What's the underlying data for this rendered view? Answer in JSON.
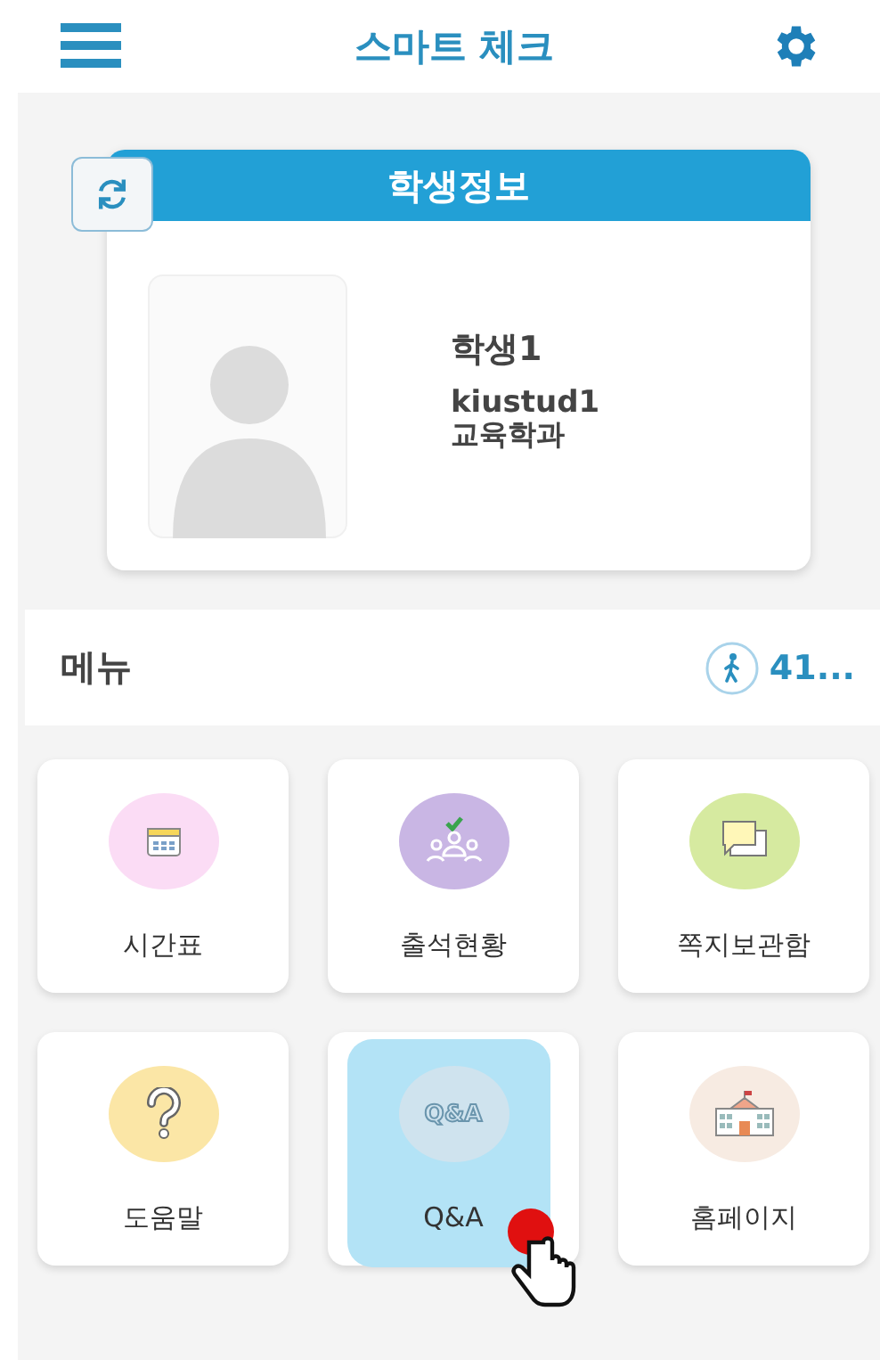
{
  "header": {
    "title": "스마트 체크"
  },
  "student_card": {
    "title": "학생정보",
    "name": "학생1",
    "id": "kiustud1",
    "department": "교육학과"
  },
  "menu_bar": {
    "title": "메뉴",
    "count": "41..."
  },
  "menu_items": [
    {
      "label": "시간표",
      "color": "#fbdcf5",
      "selected": false
    },
    {
      "label": "출석현황",
      "color": "#c9b6e4",
      "selected": false
    },
    {
      "label": "쪽지보관함",
      "color": "#d6eaa0",
      "selected": false
    },
    {
      "label": "도움말",
      "color": "#fbe6a6",
      "selected": false
    },
    {
      "label": "Q&A",
      "color": "#cfe3ee",
      "selected": true,
      "icon_text": "Q&A"
    },
    {
      "label": "홈페이지",
      "color": "#f7ebe2",
      "selected": false
    }
  ]
}
